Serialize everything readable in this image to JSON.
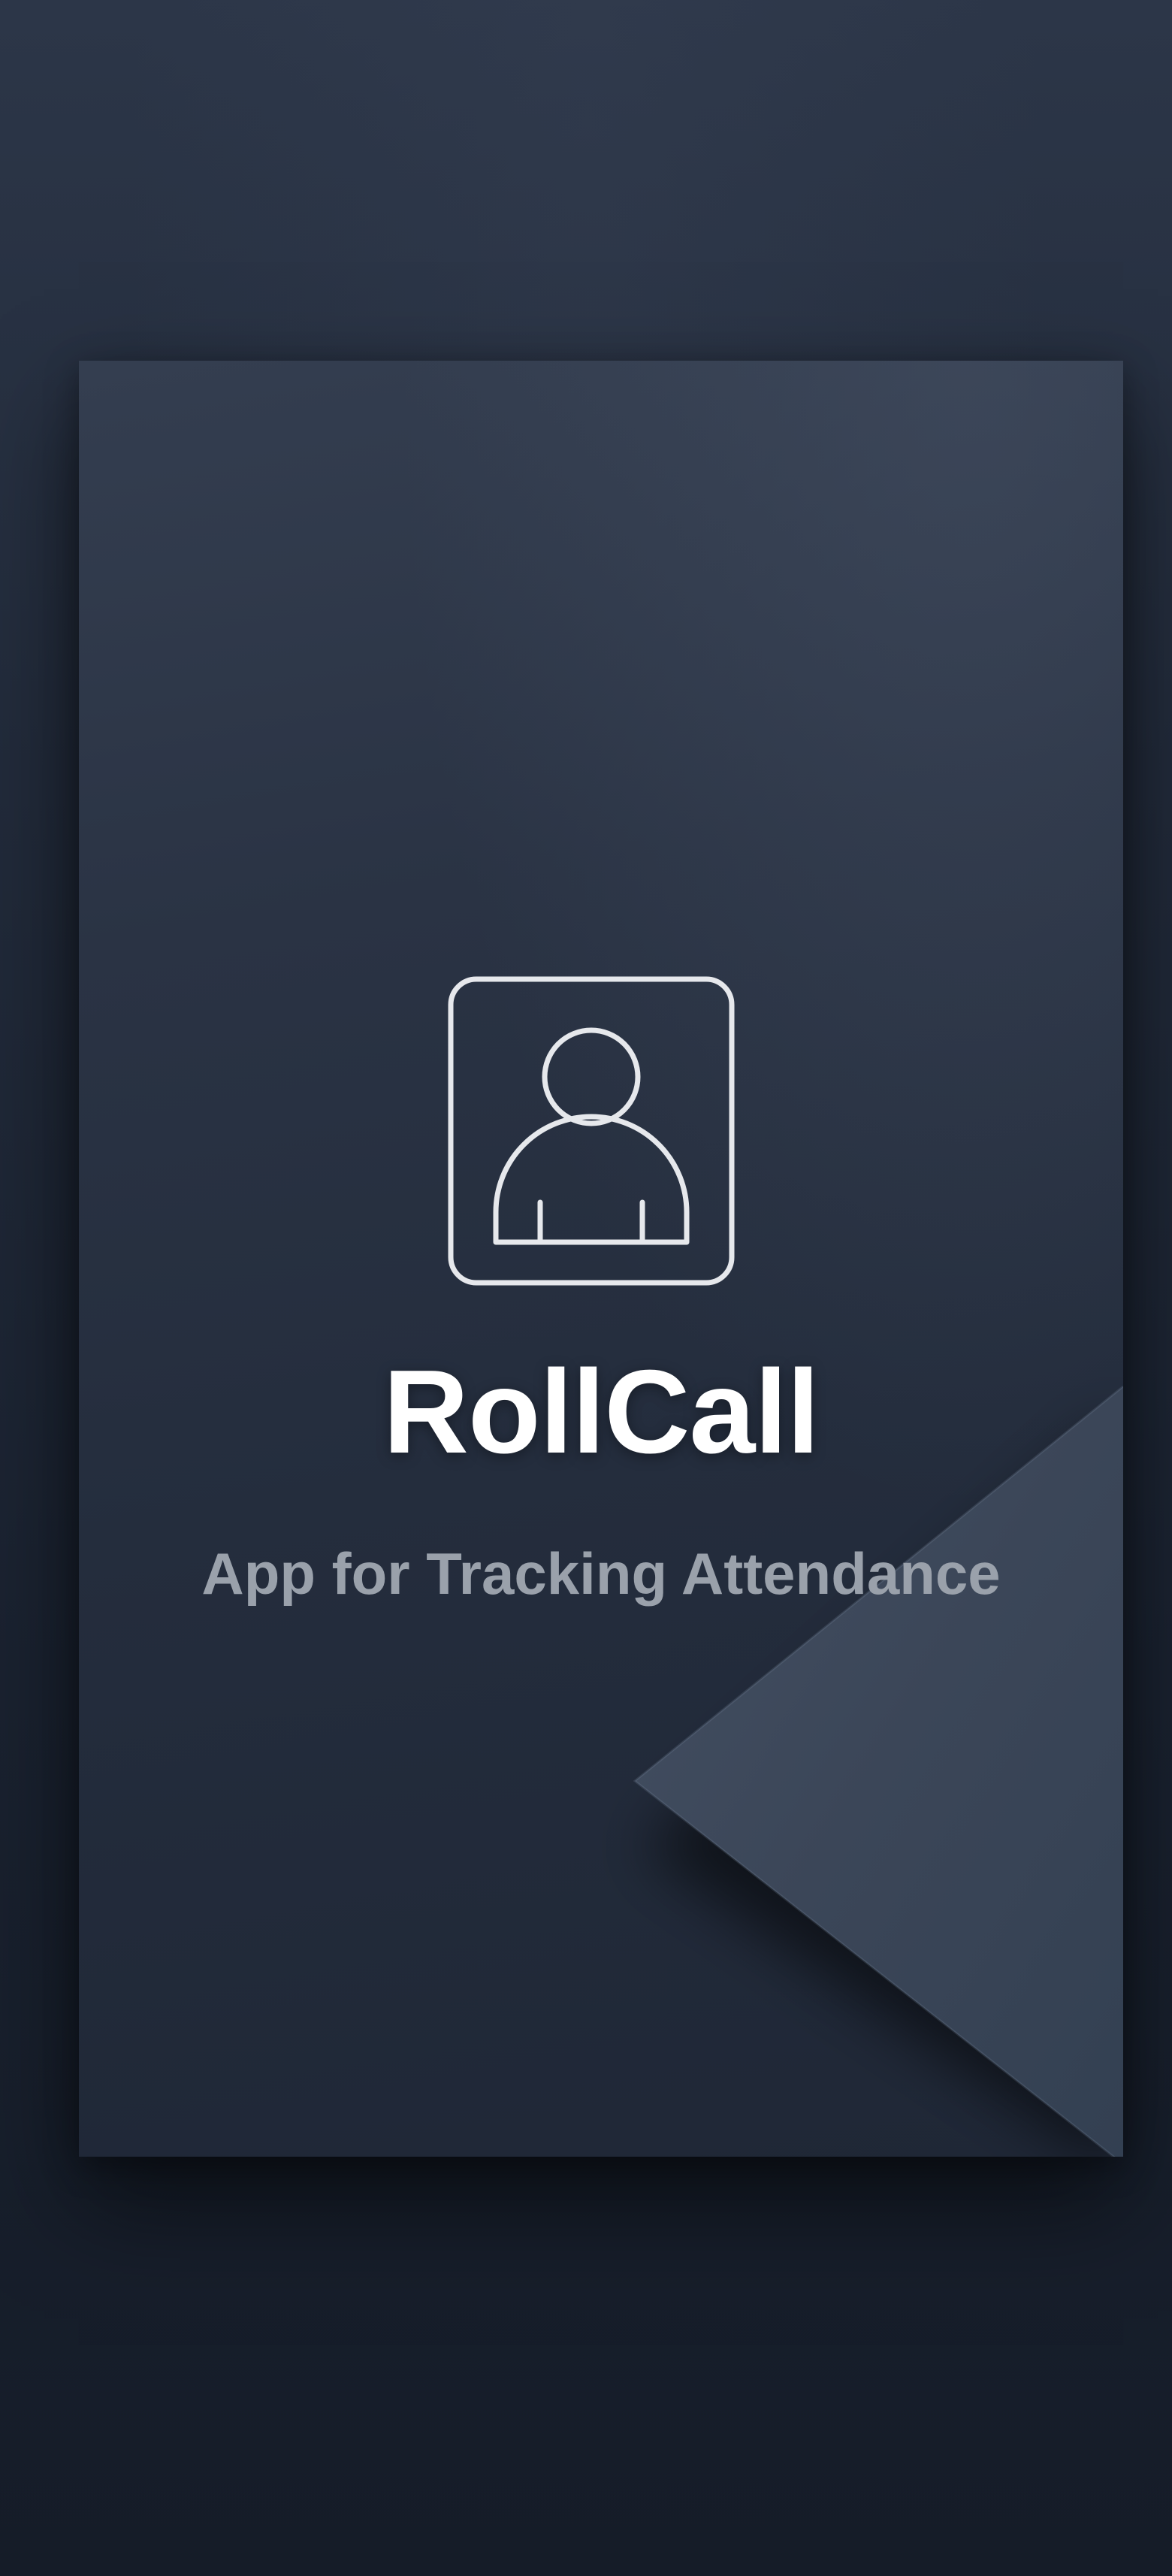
{
  "splash": {
    "app_name": "RollCall",
    "tagline": "App for Tracking Attendance",
    "logo_icon": "user-badge-icon"
  },
  "colors": {
    "background": "#1f2736",
    "card": "#2a3344",
    "fold": "#3b4658",
    "title": "#ffffff",
    "tagline": "#9aa1ab",
    "icon_stroke": "#e6e8ec"
  }
}
